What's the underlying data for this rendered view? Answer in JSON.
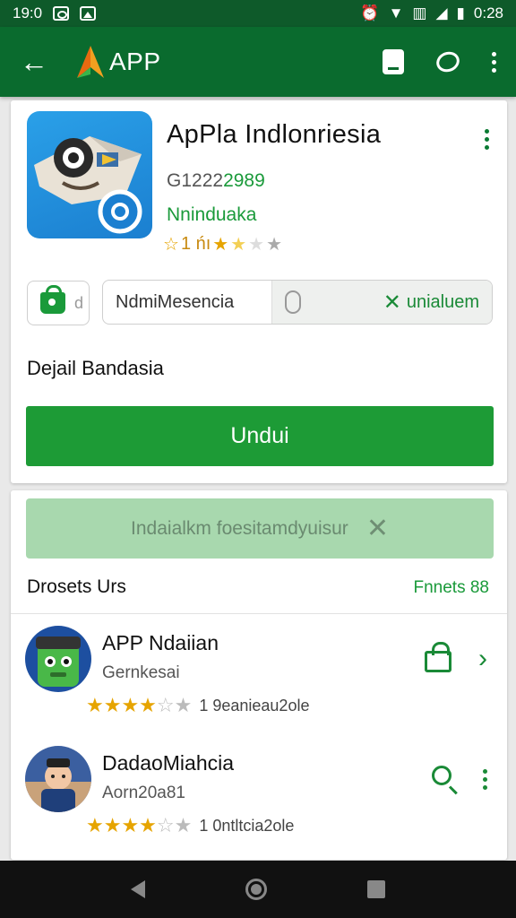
{
  "status_bar": {
    "left_text": "19:0",
    "time": "0:28"
  },
  "app_bar": {
    "title": "APP"
  },
  "app": {
    "name": "ApPla Indlonriesia",
    "id_prefix": "G1222",
    "id_suffix": "2989",
    "developer": "Nninduaka",
    "rating_label": "1 ńı"
  },
  "search": {
    "query": "NdmiMesencia",
    "chip_char": "d",
    "action_label": "unialuem"
  },
  "detail_label": "Dejail Bandasia",
  "install_button": "Undui",
  "banner": {
    "text": "Indaialkm foesitamdyuisur"
  },
  "section": {
    "title": "Drosets Urs",
    "link": "Fnnets 88"
  },
  "list": [
    {
      "name": "APP Ndaiian",
      "subtitle": "Gernkesai",
      "count": "1 9eanieau2ole",
      "rating": 3.5
    },
    {
      "name": "DadaoMiahcia",
      "subtitle": "Aorn20a81",
      "count": "1 0ntltcia2ole",
      "rating": 3.5
    }
  ],
  "colors": {
    "status_bar": "#0e5a2a",
    "app_bar": "#0a6b2e",
    "accent": "#1d9b36",
    "banner": "#a8d8ae"
  }
}
